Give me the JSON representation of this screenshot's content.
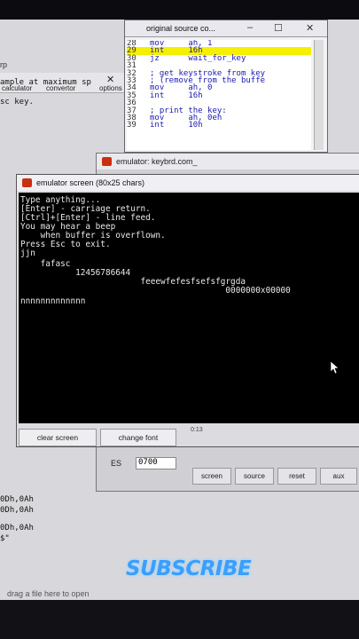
{
  "background": {
    "window_title_fragment": "rp",
    "toolbar": [
      "calculator",
      "convertor",
      "options"
    ],
    "side_text": [
      "ample at maximum sp",
      "sc key."
    ],
    "code_lines": [
      "0Dh,0Ah",
      "0Dh,0Ah",
      "0Dh,0Ah",
      "$\""
    ],
    "dropzone": "drag a file here to open"
  },
  "source_window": {
    "title": "original source co...",
    "lines": [
      {
        "n": "28",
        "code": "mov     ah, 1"
      },
      {
        "n": "29",
        "code": "int     16h"
      },
      {
        "n": "30",
        "code": "jz      wait_for_key"
      },
      {
        "n": "31",
        "code": ""
      },
      {
        "n": "32",
        "code": "; get keystroke from key"
      },
      {
        "n": "33",
        "code": "; (remove from the buffe"
      },
      {
        "n": "34",
        "code": "mov     ah, 0"
      },
      {
        "n": "35",
        "code": "int     16h"
      },
      {
        "n": "36",
        "code": ""
      },
      {
        "n": "37",
        "code": "; print the key:"
      },
      {
        "n": "38",
        "code": "mov     ah, 0eh"
      },
      {
        "n": "39",
        "code": "int     10h"
      }
    ],
    "highlight_line": "29"
  },
  "emulator": {
    "title": "emulator: keybrd.com_",
    "register_label": "ES",
    "register_value": "0700",
    "buttons": [
      "screen",
      "source",
      "reset",
      "aux"
    ]
  },
  "screen_window": {
    "title": "emulator screen (80x25 chars)",
    "console_lines": [
      "Type anything...",
      "[Enter] - carriage return.",
      "[Ctrl]+[Enter] - line feed.",
      "You may hear a beep",
      "    when buffer is overflown.",
      "Press Esc to exit.",
      "jjn",
      "    fafasc",
      "           12456786644",
      "                        feeewfefesfsefsfgrgda",
      "                                         0000000x00000",
      "nnnnnnnnnnnnn"
    ],
    "buttons": [
      "clear screen",
      "change font"
    ],
    "position": "0:13"
  },
  "overlay": {
    "subscribe": "SUBSCRIBE"
  }
}
